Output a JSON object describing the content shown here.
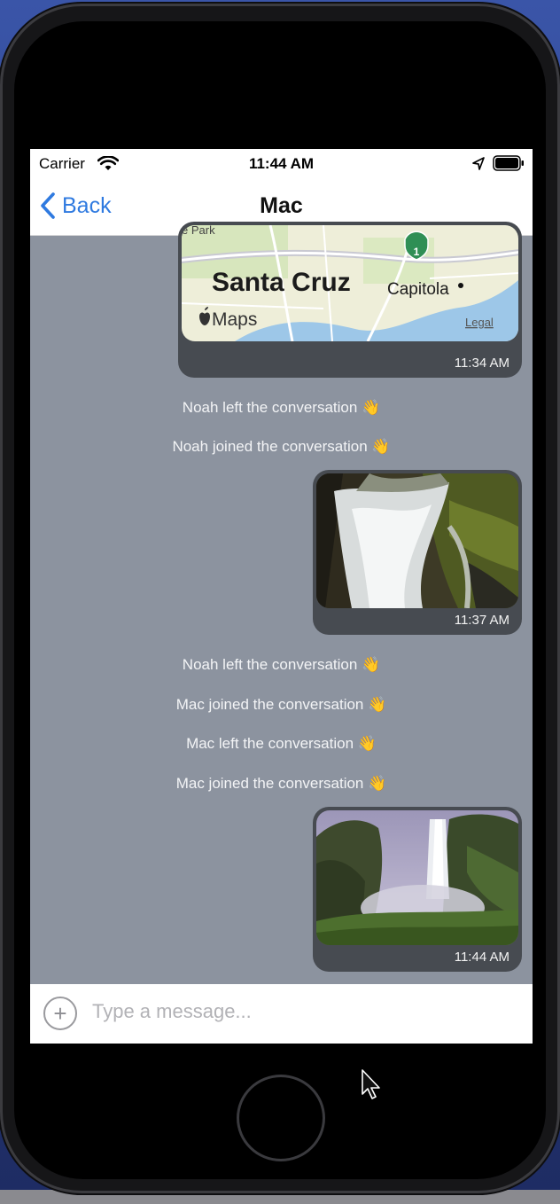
{
  "status_bar": {
    "carrier": "Carrier",
    "time": "11:44 AM",
    "icons": [
      "wifi-icon",
      "location-icon",
      "battery-icon"
    ]
  },
  "nav": {
    "back_label": "Back",
    "title": "Mac"
  },
  "map": {
    "city": "Santa Cruz",
    "town": "Capitola",
    "partial_label": "e Park",
    "attribution": "Maps",
    "legal": "Legal",
    "route_shield": "1"
  },
  "messages": [
    {
      "type": "map",
      "time": "11:34 AM"
    },
    {
      "type": "system",
      "text": "Noah left the conversation 👋"
    },
    {
      "type": "system",
      "text": "Noah joined the conversation 👋"
    },
    {
      "type": "image",
      "subject": "waterfall close-up",
      "time": "11:37 AM"
    },
    {
      "type": "system",
      "text": "Noah left the conversation 👋"
    },
    {
      "type": "system",
      "text": "Mac joined the conversation 👋"
    },
    {
      "type": "system",
      "text": "Mac left the conversation 👋"
    },
    {
      "type": "system",
      "text": "Mac joined the conversation 👋"
    },
    {
      "type": "image",
      "subject": "waterfall valley",
      "time": "11:44 AM"
    }
  ],
  "input": {
    "placeholder": "Type a message...",
    "value": "",
    "plus_icon": "plus-circle-icon"
  },
  "colors": {
    "chat_background": "#8c939f",
    "bubble": "#474b51",
    "accent": "#2f7ae0"
  }
}
